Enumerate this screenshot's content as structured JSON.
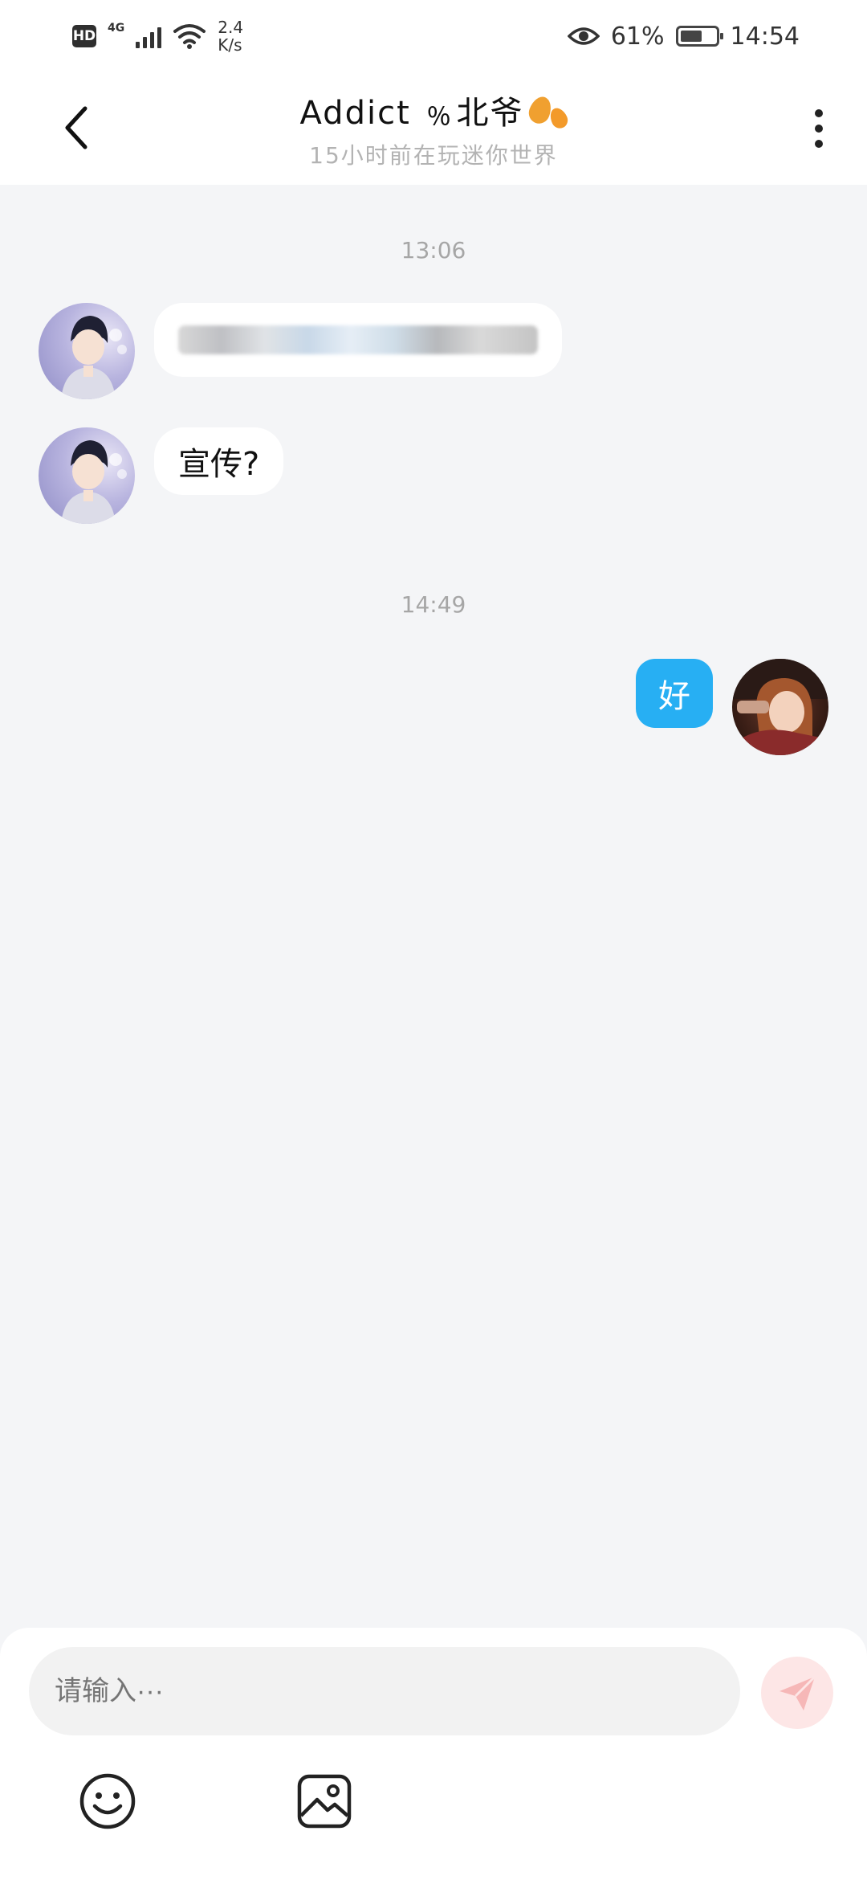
{
  "status_bar": {
    "hd": "HD",
    "network": "4G",
    "speed_value": "2.4",
    "speed_unit": "K/s",
    "battery_percent": "61%",
    "battery_level": 0.61,
    "time": "14:54"
  },
  "header": {
    "title": "Addict ﹪北爷",
    "subtitle": "15小时前在玩迷你世界"
  },
  "messages": [
    {
      "timestamp": "13:06"
    },
    {
      "sender": "other",
      "text": "",
      "redacted": true
    },
    {
      "sender": "other",
      "text": "宣传?"
    },
    {
      "timestamp": "14:49"
    },
    {
      "sender": "me",
      "text": "好"
    }
  ],
  "composer": {
    "placeholder": "请输入···"
  },
  "colors": {
    "accent": "#27aff3",
    "send_button_bg": "#fde6e6",
    "background": "#f4f5f7"
  },
  "icons": {
    "back": "chevron-left-icon",
    "more": "more-vertical-icon",
    "send": "paper-plane-icon",
    "emoji": "smiley-icon",
    "image": "image-icon"
  }
}
